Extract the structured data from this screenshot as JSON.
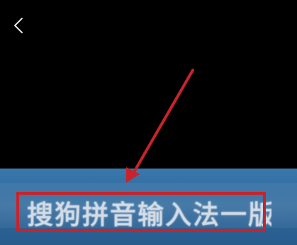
{
  "header": {
    "back_icon": "chevron-left-icon"
  },
  "banner": {
    "title": "搜狗拼音输入法一版"
  },
  "annotation": {
    "arrow_color": "#c8232b",
    "box_color": "#c8232b"
  },
  "colors": {
    "background": "#000000",
    "banner": "#2f6a9e",
    "banner_text": "#d4dde7"
  }
}
